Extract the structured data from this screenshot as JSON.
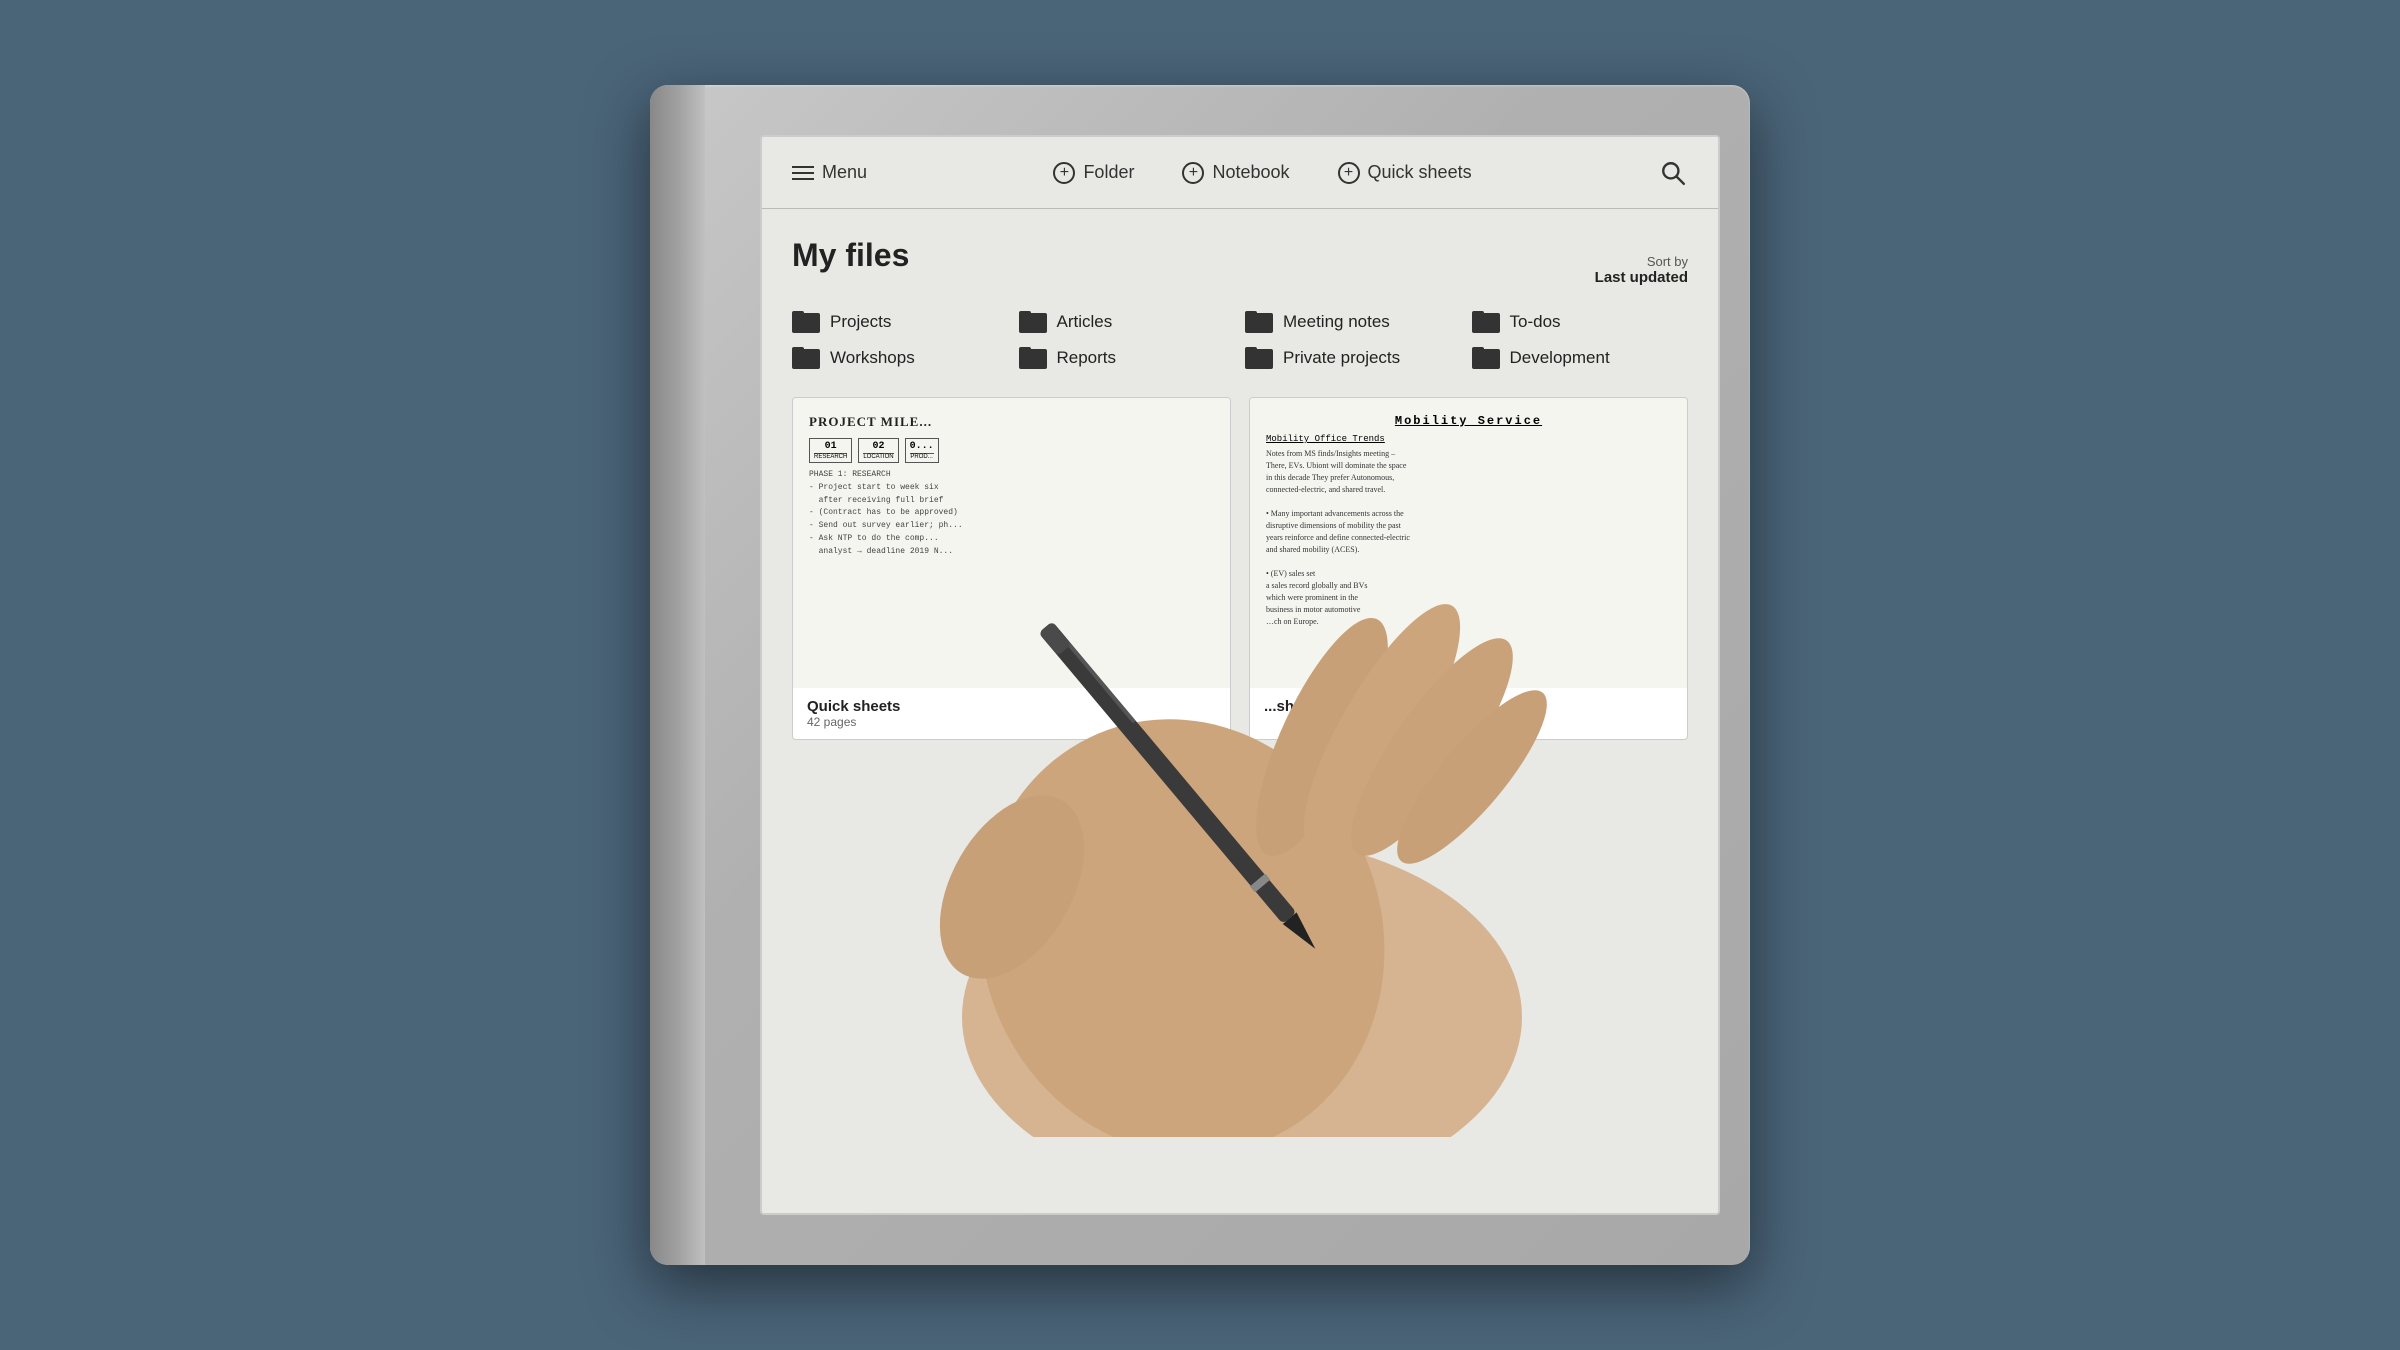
{
  "device": {
    "background_color": "#4a6478"
  },
  "navbar": {
    "menu_label": "Menu",
    "folder_label": "Folder",
    "notebook_label": "Notebook",
    "quicksheets_label": "Quick sheets",
    "search_icon": "search-icon"
  },
  "files_section": {
    "title": "My files",
    "sort_by_label": "Sort by",
    "sort_value": "Last updated"
  },
  "folders": [
    {
      "name": "Projects",
      "id": "projects"
    },
    {
      "name": "Articles",
      "id": "articles"
    },
    {
      "name": "Meeting notes",
      "id": "meeting-notes"
    },
    {
      "name": "To-dos",
      "id": "to-dos"
    },
    {
      "name": "Workshops",
      "id": "workshops"
    },
    {
      "name": "Reports",
      "id": "reports"
    },
    {
      "name": "Private projects",
      "id": "private-projects"
    },
    {
      "name": "Development",
      "id": "development"
    }
  ],
  "cards": [
    {
      "id": "quick-sheets-card",
      "preview_title": "Project Mile...",
      "title": "Quick sheets",
      "subtitle": "42 pages"
    },
    {
      "id": "mobility-service-card",
      "preview_title": "Mobility Service",
      "preview_subtitle": "Mobility Office Trends",
      "title": "...sheets",
      "subtitle": ""
    }
  ]
}
